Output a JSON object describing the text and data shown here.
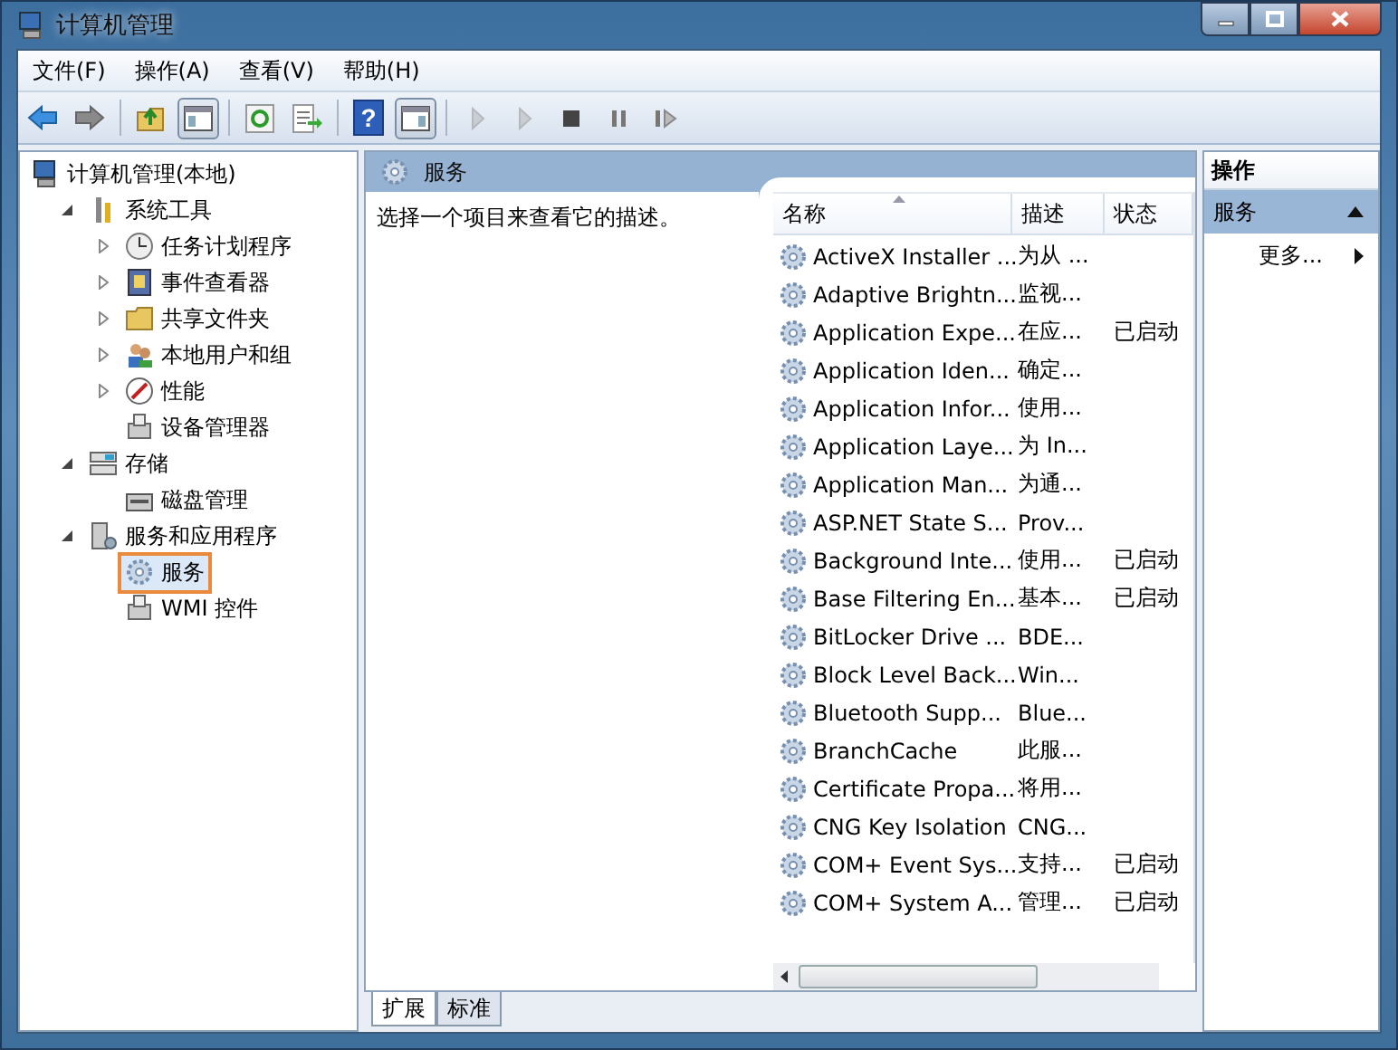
{
  "window": {
    "title": "计算机管理"
  },
  "menu": [
    "文件(F)",
    "操作(A)",
    "查看(V)",
    "帮助(H)"
  ],
  "toolbar": [
    {
      "kind": "back",
      "on": false,
      "disabled": false
    },
    {
      "kind": "forward",
      "on": false,
      "disabled": false
    },
    {
      "kind": "sep"
    },
    {
      "kind": "up",
      "on": false,
      "disabled": false
    },
    {
      "kind": "tree",
      "on": true,
      "disabled": false
    },
    {
      "kind": "sep"
    },
    {
      "kind": "refresh",
      "on": false,
      "disabled": false
    },
    {
      "kind": "export",
      "on": false,
      "disabled": false
    },
    {
      "kind": "sep"
    },
    {
      "kind": "help",
      "glyph": "?",
      "on": false,
      "disabled": false
    },
    {
      "kind": "pane",
      "on": true,
      "disabled": false
    },
    {
      "kind": "sep"
    },
    {
      "kind": "play",
      "on": false,
      "disabled": true
    },
    {
      "kind": "play",
      "on": false,
      "disabled": true
    },
    {
      "kind": "stop",
      "on": false,
      "disabled": false
    },
    {
      "kind": "pause",
      "on": false,
      "disabled": false
    },
    {
      "kind": "resume",
      "on": false,
      "disabled": false
    }
  ],
  "tree": [
    {
      "label": "计算机管理(本地)",
      "kind": "computer",
      "selected": false,
      "children": [
        {
          "label": "系统工具",
          "kind": "tools",
          "expanded": true,
          "selected": false,
          "children": [
            {
              "label": "任务计划程序",
              "kind": "clock",
              "expanded": false,
              "selected": false
            },
            {
              "label": "事件查看器",
              "kind": "book",
              "expanded": false,
              "selected": false
            },
            {
              "label": "共享文件夹",
              "kind": "folder",
              "expanded": false,
              "selected": false
            },
            {
              "label": "本地用户和组",
              "kind": "users",
              "expanded": false,
              "selected": false
            },
            {
              "label": "性能",
              "kind": "gauge",
              "expanded": false,
              "selected": false
            },
            {
              "label": "设备管理器",
              "kind": "device",
              "selected": false
            }
          ]
        },
        {
          "label": "存储",
          "kind": "storage",
          "expanded": true,
          "selected": false,
          "children": [
            {
              "label": "磁盘管理",
              "kind": "disk",
              "selected": false
            }
          ]
        },
        {
          "label": "服务和应用程序",
          "kind": "server",
          "expanded": true,
          "selected": false,
          "children": [
            {
              "label": "服务",
              "kind": "gear",
              "selected": true
            },
            {
              "label": "WMI 控件",
              "kind": "device",
              "selected": false
            }
          ]
        }
      ]
    }
  ],
  "center": {
    "title": "服务",
    "description": "选择一个项目来查看它的描述。",
    "columns": [
      {
        "label": "名称",
        "sorted": true
      },
      {
        "label": "描述",
        "sorted": false
      },
      {
        "label": "状态",
        "sorted": false
      }
    ],
    "rows": [
      [
        "ActiveX Installer ...",
        "为从 ...",
        ""
      ],
      [
        "Adaptive Brightn...",
        "监视...",
        ""
      ],
      [
        "Application Expe...",
        "在应...",
        "已启动"
      ],
      [
        "Application Iden...",
        "确定...",
        ""
      ],
      [
        "Application Infor...",
        "使用...",
        ""
      ],
      [
        "Application Laye...",
        "为 In...",
        ""
      ],
      [
        "Application Man...",
        "为通...",
        ""
      ],
      [
        "ASP.NET State S...",
        "Prov...",
        ""
      ],
      [
        "Background Inte...",
        "使用...",
        "已启动"
      ],
      [
        "Base Filtering En...",
        "基本...",
        "已启动"
      ],
      [
        "BitLocker Drive ...",
        "BDE...",
        ""
      ],
      [
        "Block Level Back...",
        "Win...",
        ""
      ],
      [
        "Bluetooth Supp...",
        "Blue...",
        ""
      ],
      [
        "BranchCache",
        "此服...",
        ""
      ],
      [
        "Certificate Propa...",
        "将用...",
        ""
      ],
      [
        "CNG Key Isolation",
        "CNG...",
        ""
      ],
      [
        "COM+ Event Sys...",
        "支持...",
        "已启动"
      ],
      [
        "COM+ System A...",
        "管理...",
        "已启动"
      ]
    ],
    "tabs": [
      {
        "label": "扩展",
        "selected": true
      },
      {
        "label": "标准",
        "selected": false
      }
    ]
  },
  "actions": {
    "title": "操作",
    "section": {
      "label": "服务",
      "expanded": true
    },
    "items": [
      "更多..."
    ]
  }
}
